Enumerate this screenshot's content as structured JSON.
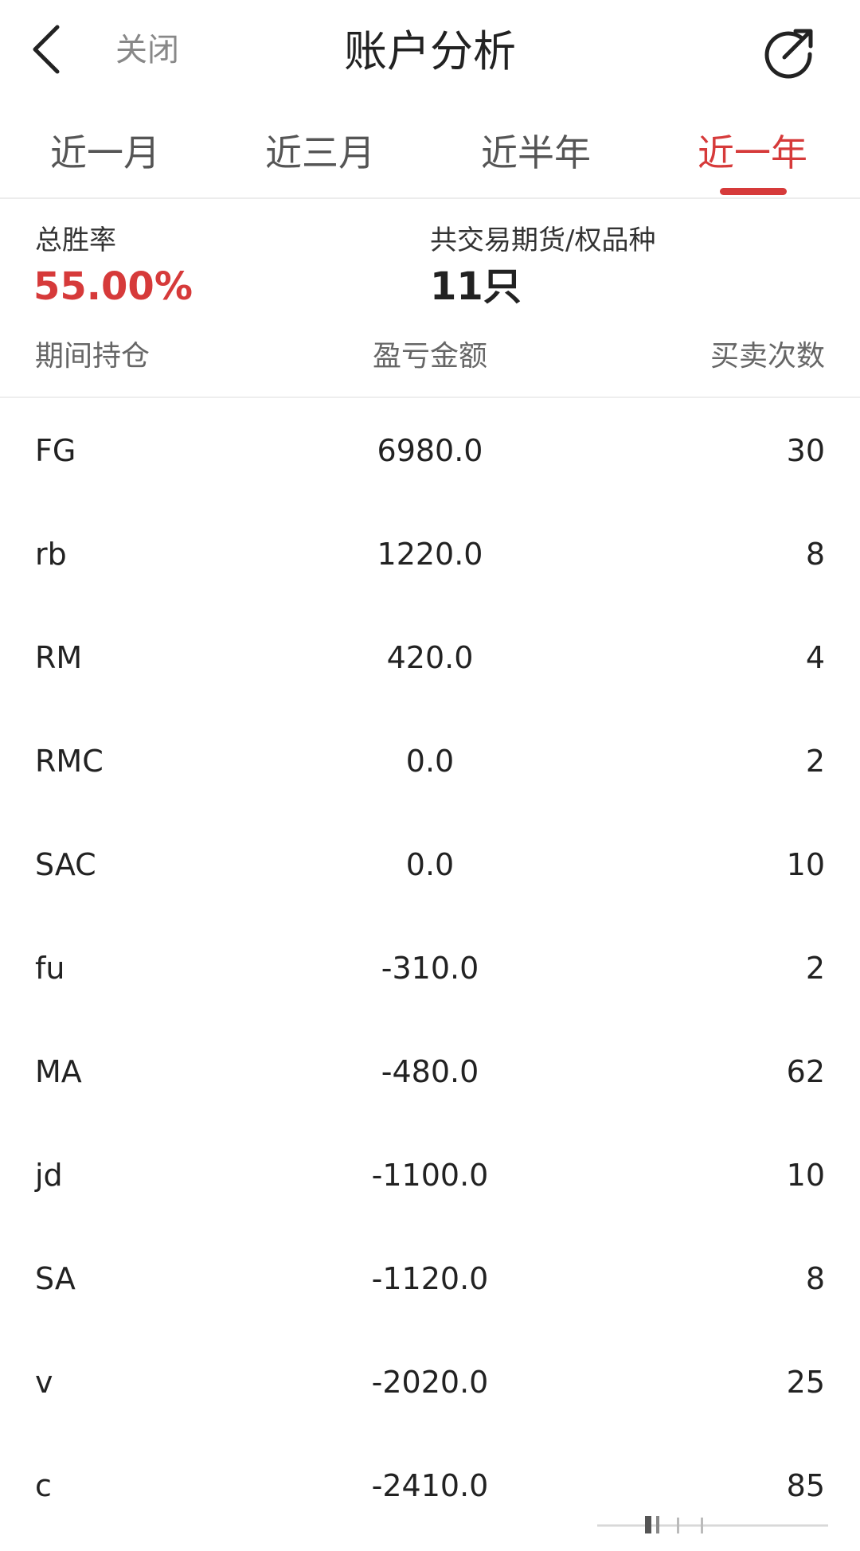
{
  "nav": {
    "back_icon": "chevron-left-icon",
    "close_label": "关闭",
    "title": "账户分析",
    "share_icon": "share-export-icon"
  },
  "tabs": [
    {
      "label": "近一月",
      "active": false
    },
    {
      "label": "近三月",
      "active": false
    },
    {
      "label": "近半年",
      "active": false
    },
    {
      "label": "近一年",
      "active": true
    }
  ],
  "summary": {
    "win_rate_label": "总胜率",
    "win_rate_value": "55.00%",
    "varieties_label": "共交易期货/权品种",
    "varieties_value": "11只"
  },
  "table": {
    "headers": [
      "期间持仓",
      "盈亏金额",
      "买卖次数"
    ],
    "rows": [
      {
        "name": "FG",
        "pl": "6980.0",
        "count": "30"
      },
      {
        "name": "rb",
        "pl": "1220.0",
        "count": "8"
      },
      {
        "name": "RM",
        "pl": "420.0",
        "count": "4"
      },
      {
        "name": "RMC",
        "pl": "0.0",
        "count": "2"
      },
      {
        "name": "SAC",
        "pl": "0.0",
        "count": "10"
      },
      {
        "name": "fu",
        "pl": "-310.0",
        "count": "2"
      },
      {
        "name": "MA",
        "pl": "-480.0",
        "count": "62"
      },
      {
        "name": "jd",
        "pl": "-1100.0",
        "count": "10"
      },
      {
        "name": "SA",
        "pl": "-1120.0",
        "count": "8"
      },
      {
        "name": "v",
        "pl": "-2020.0",
        "count": "25"
      },
      {
        "name": "c",
        "pl": "-2410.0",
        "count": "85"
      }
    ]
  },
  "colors": {
    "accent": "#d63a3a",
    "text_primary": "#222222",
    "text_secondary": "#666666",
    "divider": "#eeeeee"
  }
}
